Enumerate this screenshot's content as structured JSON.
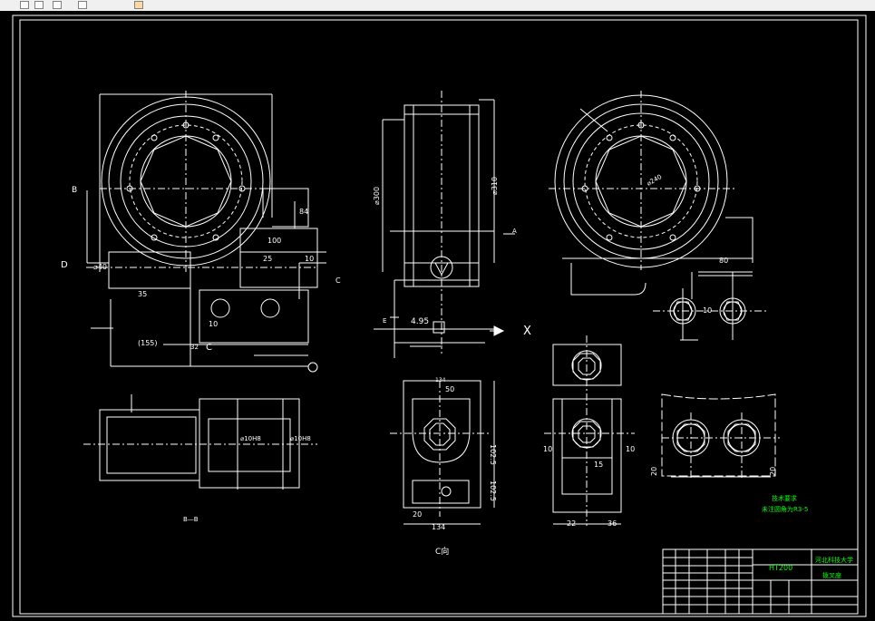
{
  "toolbar": {
    "icons": [
      "pencil-icon",
      "window-icon",
      "window-icon",
      "chevron-icon",
      "bug-icon"
    ]
  },
  "colors": {
    "background": "#000000",
    "lines": "#ffffff",
    "title_text": "#00ff00",
    "accent_marker": "#ff0000"
  },
  "labels": {
    "B_left": "B",
    "D": "D",
    "C_right": "C",
    "c_small": "C",
    "A_small": "A",
    "dim_phi40": "⌀40",
    "dim_35": "35",
    "dim_25": "25",
    "dim_10a": "10",
    "dim_84": "84",
    "dim_100": "100",
    "dim_10b": "10",
    "dim_155": "(155)",
    "dim_32": "32",
    "dim_phi300": "⌀300",
    "dim_phi310": "⌀310",
    "dim_495": "4.95",
    "E": "E",
    "X": "X",
    "dim_80": "80",
    "dim_10c": "10",
    "dim_phi240": "⌀240",
    "section_BB": "B—B",
    "dim_phi10H8a": "⌀10H8",
    "dim_phi10H8b": "⌀10H8",
    "dim_134_top": "134",
    "dim_50": "50",
    "dim_1025a": "102.5",
    "dim_1025b": "102.5",
    "dim_20": "20",
    "dim_134_bottom": "134",
    "view_C": "C向",
    "dim_10d": "10",
    "dim_10e": "10",
    "dim_15": "15",
    "dim_22": "22",
    "dim_36": "36",
    "dim_20b": "20",
    "dim_20c": "20",
    "tech_req_1": "技术要求",
    "tech_req_2": "未注圆角为R3-5",
    "material": "HT200",
    "school": "河北科技大学",
    "part_name": "拨叉座"
  }
}
